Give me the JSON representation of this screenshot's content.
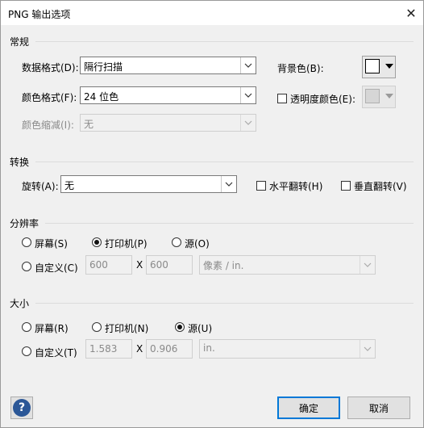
{
  "window": {
    "title": "PNG 输出选项",
    "close_glyph": "✕"
  },
  "general": {
    "title": "常规",
    "data_format_label": "数据格式(D):",
    "data_format_value": "隔行扫描",
    "color_format_label": "颜色格式(F):",
    "color_format_value": "24 位色",
    "color_reduce_label": "颜色缩减(I):",
    "color_reduce_value": "无",
    "background_label": "背景色(B):",
    "transparent_label": "透明度颜色(E):",
    "background_color": "#ffffff",
    "transparent_checked": false
  },
  "transform": {
    "title": "转换",
    "rotate_label": "旋转(A):",
    "rotate_value": "无",
    "flip_h_label": "水平翻转(H)",
    "flip_v_label": "垂直翻转(V)",
    "flip_h_checked": false,
    "flip_v_checked": false
  },
  "resolution": {
    "title": "分辨率",
    "options": [
      "屏幕(S)",
      "打印机(P)",
      "源(O)"
    ],
    "selected": "打印机(P)",
    "custom_label": "自定义(C)",
    "x_value": "600",
    "times": "X",
    "y_value": "600",
    "unit_value": "像素 / in."
  },
  "size": {
    "title": "大小",
    "options": [
      "屏幕(R)",
      "打印机(N)",
      "源(U)"
    ],
    "selected": "源(U)",
    "custom_label": "自定义(T)",
    "w_value": "1.583",
    "times": "X",
    "h_value": "0.906",
    "unit_value": "in."
  },
  "footer": {
    "help_icon": "?",
    "ok_label": "确定",
    "cancel_label": "取消"
  },
  "colors": {
    "accent": "#0078d7",
    "help_bg": "#2b5797",
    "dialog_bg": "#f0f0f0"
  }
}
